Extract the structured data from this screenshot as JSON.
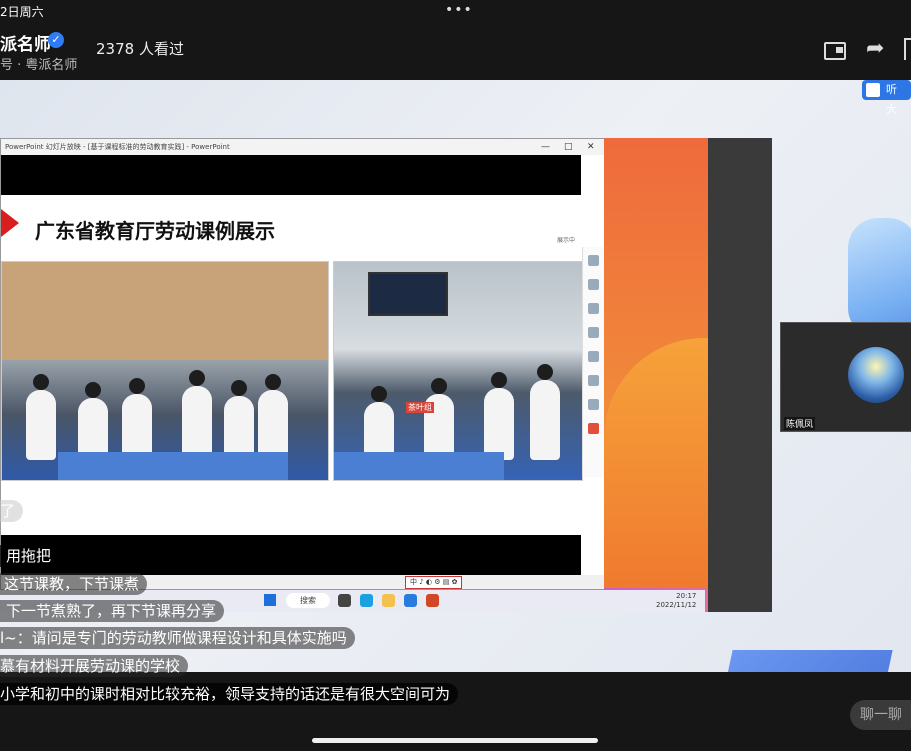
{
  "status_bar": {
    "time": "2日周六",
    "more": "•••"
  },
  "header": {
    "channel_name": "派名师",
    "verified_icon": "✓",
    "channel_sub": "号 · 粤派名师",
    "viewers": "2378 人看过",
    "share_icon": "➦"
  },
  "stage": {
    "listen_badge": "听大",
    "ppt": {
      "titlebar": "PowerPoint 幻灯片放映 - [基于课程标准的劳动教育实践] - PowerPoint",
      "win_controls": [
        "—",
        "□",
        "✕"
      ],
      "slide_title": "广东省教育厅劳动课例展示",
      "slide_note": "展示中",
      "ime": "中 ♪ ◐ ⚙ ▤ ✿",
      "sign_left": "",
      "sign_right": "茶叶组"
    },
    "taskbar": {
      "search": "搜索",
      "time": "20:17",
      "date": "2022/11/12"
    },
    "camera": {
      "name": "陈佩凤"
    }
  },
  "comments": [
    {
      "text": "了",
      "style": "light"
    },
    {
      "text": "用拖把",
      "style": "dark"
    },
    {
      "text": "这节课教，下节课煮",
      "style": "normal"
    },
    {
      "text": "下一节煮熟了，再下节课再分享",
      "style": "normal"
    },
    {
      "text": "l~：请问是专门的劳动教师做课程设计和具体实施吗",
      "style": "normal"
    },
    {
      "text": "慕有材料开展劳动课的学校",
      "style": "normal"
    },
    {
      "text": "小学和初中的课时相对比较充裕，领导支持的话还是有很大空间可为",
      "style": "dark"
    }
  ],
  "chat_button": "聊一聊"
}
